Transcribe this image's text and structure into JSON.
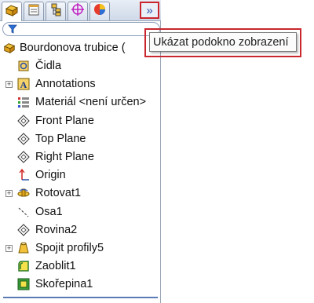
{
  "tabs": [
    {
      "icon": "feature-manager-icon"
    },
    {
      "icon": "property-manager-icon"
    },
    {
      "icon": "configuration-manager-icon"
    },
    {
      "icon": "dimxpert-manager-icon"
    },
    {
      "icon": "display-manager-icon"
    }
  ],
  "expand_button": {
    "label": "»"
  },
  "tooltip": {
    "text": "Ukázat podokno zobrazení"
  },
  "tree": {
    "root": {
      "label": "Bourdonova trubice",
      "suffix": "("
    },
    "items": [
      {
        "label": "Čidla",
        "icon": "sensors-icon",
        "expandable": false
      },
      {
        "label": "Annotations",
        "icon": "annotations-icon",
        "expandable": true
      },
      {
        "label": "Materiál <není určen>",
        "icon": "material-icon",
        "expandable": false
      },
      {
        "label": "Front Plane",
        "icon": "plane-icon",
        "expandable": false
      },
      {
        "label": "Top Plane",
        "icon": "plane-icon",
        "expandable": false
      },
      {
        "label": "Right Plane",
        "icon": "plane-icon",
        "expandable": false
      },
      {
        "label": "Origin",
        "icon": "origin-icon",
        "expandable": false
      },
      {
        "label": "Rotovat1",
        "icon": "revolve-icon",
        "expandable": true
      },
      {
        "label": "Osa1",
        "icon": "axis-icon",
        "expandable": false
      },
      {
        "label": "Rovina2",
        "icon": "plane-icon",
        "expandable": false
      },
      {
        "label": "Spojit profily5",
        "icon": "loft-icon",
        "expandable": true
      },
      {
        "label": "Zaoblit1",
        "icon": "fillet-icon",
        "expandable": false
      },
      {
        "label": "Skořepina1",
        "icon": "shell-icon",
        "expandable": false
      }
    ]
  },
  "colors": {
    "highlight_border": "#c9262d",
    "accent": "#2b4fa8"
  }
}
